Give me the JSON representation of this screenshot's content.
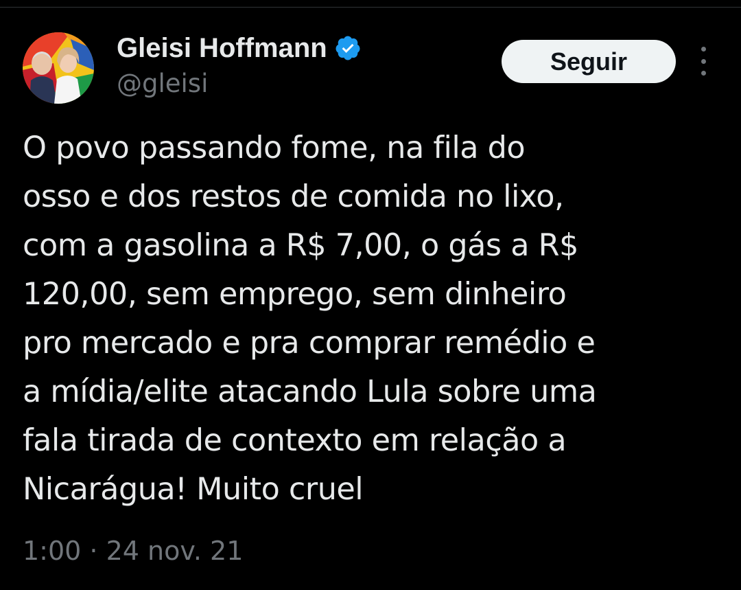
{
  "author": {
    "display_name": "Gleisi Hoffmann",
    "handle": "@gleisi",
    "verified_icon": "verified-badge-icon",
    "avatar": "profile-photo"
  },
  "follow_button": {
    "label": "Seguir"
  },
  "more_menu": {
    "icon": "more-vertical-icon"
  },
  "tweet": {
    "text": "O povo passando fome, na fila do\nosso e dos restos de comida no lixo,\ncom a gasolina a R$ 7,00, o gás a R$\n120,00, sem emprego, sem dinheiro\npro mercado e pra comprar remédio e\na mídia/elite atacando Lula sobre uma\nfala tirada de contexto em relação a\nNicarágua! Muito cruel",
    "timestamp": "1:00 · 24 nov. 21"
  },
  "colors": {
    "background": "#000000",
    "primary_text": "#e7e9ea",
    "secondary_text": "#71767b",
    "verified_blue": "#1d9bf0",
    "button_bg": "#eff3f4",
    "button_text": "#0f1419"
  }
}
